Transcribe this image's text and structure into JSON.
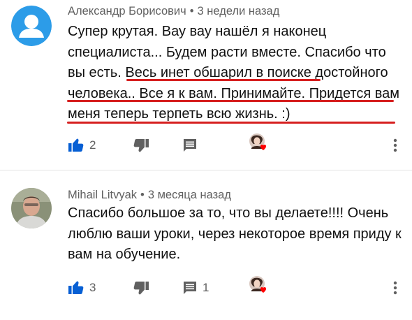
{
  "comments": [
    {
      "author": "Александр Борисович",
      "separator": "•",
      "time": "3 недели назад",
      "text": "Супер крутая. Вау вау нашёл я наконец специалиста... Будем расти вместе. Спасибо что вы есть. Весь инет обшарил в поиске достойного человека.. Все я к вам. Принимайте. Придется вам меня теперь терпеть всю жизнь. :)",
      "likes": "2",
      "replies": "",
      "avatar_color": "#2c9ce8"
    },
    {
      "author": "Mihail Litvyak",
      "separator": "•",
      "time": "3 месяца назад",
      "text": "Спасибо большое за то, что вы делаете!!!! Очень люблю ваши уроки, через некоторое время приду к вам на обучение.",
      "likes": "3",
      "replies": "1",
      "avatar_color": "#8a9178"
    }
  ],
  "colors": {
    "like_blue": "#065fd4",
    "icon_grey": "#606060",
    "underline_red": "#d61f1f",
    "heart_red": "#ff0000"
  },
  "icons": [
    "thumb-up-icon",
    "thumb-down-icon",
    "reply-icon",
    "creator-heart-icon",
    "more-vert-icon",
    "default-avatar-icon"
  ]
}
